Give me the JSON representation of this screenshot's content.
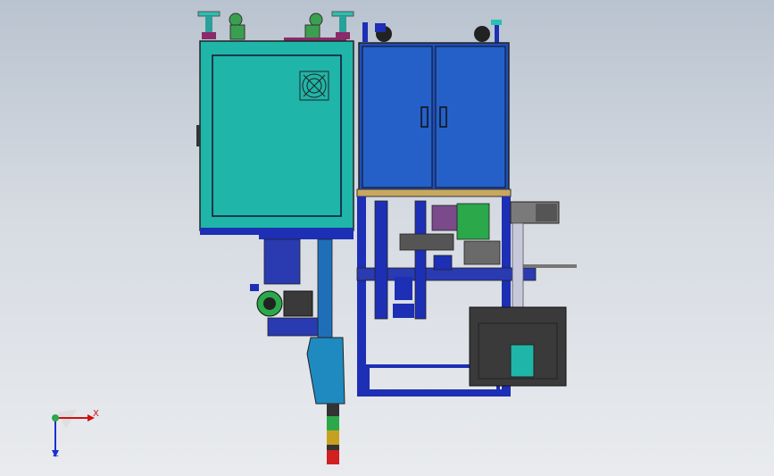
{
  "viewport": {
    "background_top": "#b9c3cf",
    "background_bottom": "#e9ebee"
  },
  "colors": {
    "teal_cabinet": "#1fb5a8",
    "blue_cabinet": "#1f4fb8",
    "frame_blue": "#1d2fb5",
    "machine_dark": "#3a3a3a",
    "accent_green": "#2aa84a",
    "accent_magenta": "#a0307a"
  },
  "icons": {
    "fan": "fan-icon",
    "triad": "coordinate-triad-icon"
  },
  "triad": {
    "x_label": "X",
    "z_label": "Z"
  }
}
